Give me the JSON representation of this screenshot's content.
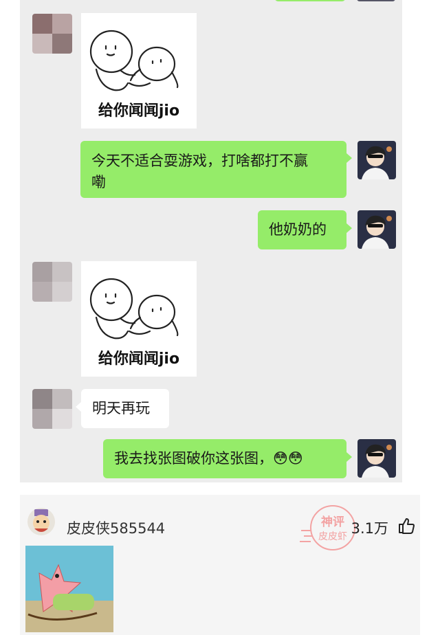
{
  "chat": {
    "messages": [
      {
        "from": "them",
        "type": "sticker",
        "caption": "给你闻闻jio"
      },
      {
        "from": "me",
        "type": "text",
        "line1": "今天不适合耍游戏，打啥都打不赢",
        "line2": "嘞"
      },
      {
        "from": "me",
        "type": "text",
        "text": "他奶奶的"
      },
      {
        "from": "them",
        "type": "sticker",
        "caption": "给你闻闻jio"
      },
      {
        "from": "them",
        "type": "text",
        "text": "明天再玩"
      },
      {
        "from": "me",
        "type": "text",
        "text": "我去找张图破你这张图，",
        "emoji": "😳😳"
      }
    ]
  },
  "comment": {
    "username": "皮皮侠585544",
    "like_count": "3.1万",
    "like_icon": "thumbs-up-icon",
    "watermark": {
      "line1": "神评",
      "line2": "皮皮虾"
    }
  },
  "colors": {
    "chat_bg": "#ededed",
    "my_bubble": "#95ec69",
    "their_bubble": "#ffffff",
    "watermark": "#f08a8a"
  }
}
